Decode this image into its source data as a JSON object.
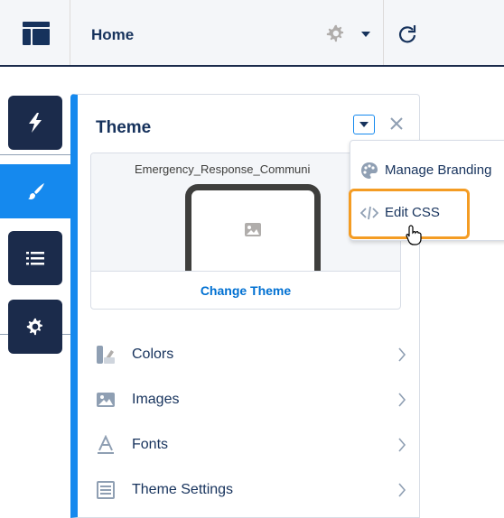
{
  "topbar": {
    "page_title": "Home",
    "icons": [
      "layout-icon",
      "gear-icon",
      "chevron-down-icon",
      "refresh-icon"
    ]
  },
  "rail": {
    "items": [
      {
        "name": "lightning-icon",
        "active": false
      },
      {
        "name": "brush-icon",
        "active": true
      },
      {
        "name": "list-icon",
        "active": false
      },
      {
        "name": "gear-icon",
        "active": false
      }
    ]
  },
  "panel": {
    "title": "Theme",
    "preview": {
      "theme_name": "Emergency_Response_Communi",
      "change_theme_label": "Change Theme"
    },
    "menu": [
      {
        "label": "Colors",
        "icon": "colors-icon"
      },
      {
        "label": "Images",
        "icon": "image-icon"
      },
      {
        "label": "Fonts",
        "icon": "font-icon"
      },
      {
        "label": "Theme Settings",
        "icon": "settings-layout-icon"
      }
    ]
  },
  "dropdown": {
    "items": [
      {
        "label": "Manage Branding",
        "icon": "palette-icon"
      },
      {
        "label": "Edit CSS",
        "icon": "code-icon",
        "highlighted": true
      }
    ]
  },
  "colors": {
    "accent": "#1589ee",
    "rail": "#1b2b4b",
    "highlight": "#f49c23",
    "link": "#0070d2"
  }
}
